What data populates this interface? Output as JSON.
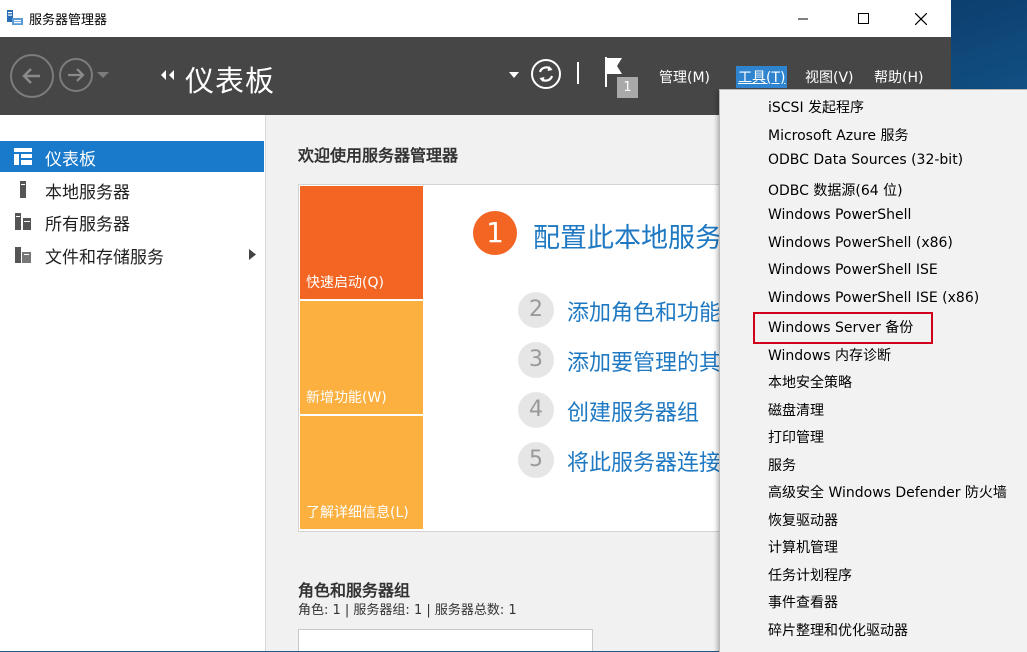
{
  "window": {
    "title": "服务器管理器"
  },
  "header": {
    "title": "仪表板",
    "notification_count": "1",
    "menu": [
      {
        "label": "管理(M)"
      },
      {
        "label": "工具(T)"
      },
      {
        "label": "视图(V)"
      },
      {
        "label": "帮助(H)"
      }
    ]
  },
  "sidebar": {
    "items": [
      {
        "label": "仪表板"
      },
      {
        "label": "本地服务器"
      },
      {
        "label": "所有服务器"
      },
      {
        "label": "文件和存储服务"
      }
    ]
  },
  "main": {
    "welcome": "欢迎使用服务器管理器",
    "tiles": [
      {
        "label": "快速启动(Q)",
        "color": "#f26522"
      },
      {
        "label": "新增功能(W)",
        "color": "#fbb040"
      },
      {
        "label": "了解详细信息(L)",
        "color": "#fbb040"
      }
    ],
    "steps": [
      {
        "num": "1",
        "text": "配置此本地服务器"
      },
      {
        "num": "2",
        "text": "添加角色和功能"
      },
      {
        "num": "3",
        "text": "添加要管理的其他服务器"
      },
      {
        "num": "4",
        "text": "创建服务器组"
      },
      {
        "num": "5",
        "text": "将此服务器连接到云服务"
      }
    ],
    "roles_title": "角色和服务器组",
    "roles_summary": "角色: 1 | 服务器组: 1 | 服务器总数: 1"
  },
  "tools_menu": {
    "items": [
      "iSCSI 发起程序",
      "Microsoft Azure 服务",
      "ODBC Data Sources (32-bit)",
      "ODBC 数据源(64 位)",
      "Windows PowerShell",
      "Windows PowerShell (x86)",
      "Windows PowerShell ISE",
      "Windows PowerShell ISE (x86)",
      "Windows Server 备份",
      "Windows 内存诊断",
      "本地安全策略",
      "磁盘清理",
      "打印管理",
      "服务",
      "高级安全 Windows Defender 防火墙",
      "恢复驱动器",
      "计算机管理",
      "任务计划程序",
      "事件查看器",
      "碎片整理和优化驱动器"
    ],
    "highlighted_item": "Windows Server 备份",
    "highlight_color": "#d0021b"
  },
  "colors": {
    "header_bg": "#464646",
    "sidebar_active": "#1979ca",
    "menu_active": "#2f84d0",
    "link_blue": "#1f79c2"
  }
}
